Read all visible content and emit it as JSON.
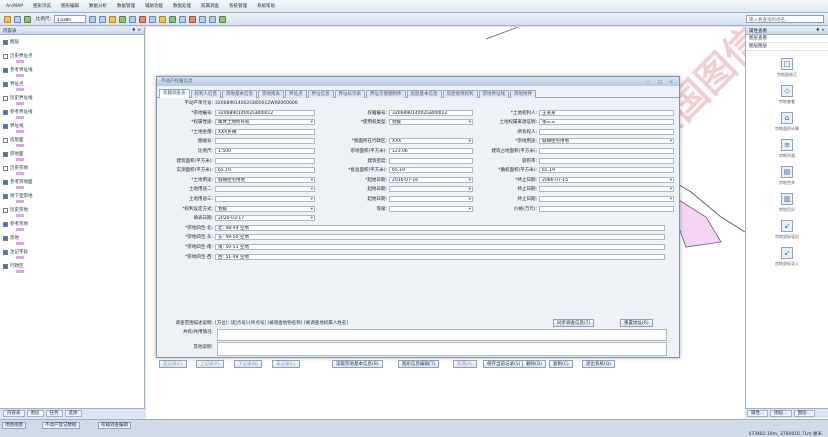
{
  "menubar": {
    "items": [
      "ArcMAP",
      "图形浏览",
      "图形编辑",
      "数据分析",
      "数据管理",
      "辅助功能",
      "数据处理",
      "权属调查",
      "系统管理",
      "系统帮助"
    ]
  },
  "toolbar": {
    "scale_label": "比例尺:",
    "scale_value": "1:1250",
    "search_placeholder": "输入要查询的地名..."
  },
  "left_panel": {
    "title": "内容表",
    "pin": "♦ ×",
    "layers": [
      {
        "name": "图层",
        "checked": true
      },
      {
        "name": "历史界址点",
        "checked": false
      },
      {
        "name": "参考界址线",
        "checked": true
      },
      {
        "name": "界址点",
        "checked": true
      },
      {
        "name": "历史界址线",
        "checked": false
      },
      {
        "name": "参考界址线",
        "checked": true
      },
      {
        "name": "界址线",
        "checked": true
      },
      {
        "name": "房屋面",
        "checked": false
      },
      {
        "name": "宗地面",
        "checked": true
      },
      {
        "name": "历史宗地",
        "checked": false
      },
      {
        "name": "参考宗地面",
        "checked": true
      },
      {
        "name": "地下室宗地",
        "checked": true
      },
      {
        "name": "历史宗地",
        "checked": false
      },
      {
        "name": "参考宗地",
        "checked": true
      },
      {
        "name": "宗地",
        "checked": true
      },
      {
        "name": "注记字段",
        "checked": true
      },
      {
        "name": "行政区",
        "checked": true
      }
    ],
    "tabs": [
      "内容表",
      "图层",
      "任务",
      "选择"
    ]
  },
  "statusbar": {
    "tabs": [
      "地图视图",
      "不动产登记数据",
      "权籍调查编辑"
    ],
    "coords": "473482.18m, 3780016.71m  厘米"
  },
  "right_panel": {
    "title": "属性查看",
    "pin": "♦ ×",
    "rows": [
      "图层查看",
      "图层图层"
    ],
    "tools": [
      {
        "glyph": "□",
        "label": "宗地面修正"
      },
      {
        "glyph": "◇",
        "label": "宗地查看"
      },
      {
        "glyph": "⌂",
        "label": "宗地面积计算"
      },
      {
        "glyph": "≡",
        "label": "宗地列表"
      },
      {
        "glyph": "▤",
        "label": "宗地合并"
      },
      {
        "glyph": "▥",
        "label": "宗地切分"
      },
      {
        "glyph": "↙",
        "label": "宗地坐标导出"
      },
      {
        "glyph": "↙",
        "label": "宗地坐标导入"
      }
    ],
    "bottom_tabs": [
      "属性...",
      "图层...",
      "图层..."
    ]
  },
  "watermark": "南京国图信息",
  "dialog": {
    "title": "不动产权籍信息",
    "tabs": [
      "权籍调查表",
      "权利人信息",
      "宗地基本信息",
      "宗地附表",
      "界址点",
      "界址信息",
      "界址标示表",
      "界址示意图附件",
      "房屋基本信息",
      "房屋他项权利",
      "宗地界址线",
      "宗地附件"
    ],
    "fields": [
      {
        "label": "不动产单元号:",
        "value": "320689014002GB00012W00000000",
        "x": 0,
        "y": 0,
        "lw": 40,
        "vw": 0
      },
      {
        "label": "*宗地编号:",
        "value": "320689014002GB00012",
        "x": 0,
        "y": 1,
        "lw": 40,
        "vw": 130
      },
      {
        "label": "权籍编号:",
        "value": "320689014002GB00012",
        "x": 1,
        "y": 1,
        "lw": 50,
        "vw": 80
      },
      {
        "label": "*土地权利人:",
        "value": "王某某",
        "x": 2,
        "y": 1,
        "lw": 40,
        "vw": 80
      },
      {
        "label": "*权属性质:",
        "value": "集体土地所有权",
        "x": 0,
        "y": 2,
        "lw": 40,
        "vw": 130,
        "sel": true
      },
      {
        "label": "*使用权类型:",
        "value": "划拨",
        "x": 1,
        "y": 2,
        "lw": 50,
        "vw": 80,
        "sel": true
      },
      {
        "label": "土地权属来源证明:",
        "value": "张三三",
        "x": 2,
        "y": 2,
        "lw": 40,
        "vw": 80
      },
      {
        "label": "*土地坐落:",
        "value": "XXX乡镇",
        "x": 0,
        "y": 3,
        "lw": 40,
        "vw": 130
      },
      {
        "label": "所有权人:",
        "value": "",
        "x": 2,
        "y": 3,
        "lw": 40,
        "vw": 80
      },
      {
        "label": "图幅号:",
        "value": "",
        "x": 0,
        "y": 4,
        "lw": 40,
        "vw": 130
      },
      {
        "label": "*图面所在行政区:",
        "value": "XXX",
        "x": 1,
        "y": 4,
        "lw": 50,
        "vw": 80,
        "sel": true
      },
      {
        "label": "*宗地用途:",
        "value": "城镇住宅用地",
        "x": 2,
        "y": 4,
        "lw": 40,
        "vw": 80,
        "sel": true
      },
      {
        "label": "比例尺:",
        "value": "1:500",
        "x": 0,
        "y": 5,
        "lw": 40,
        "vw": 130
      },
      {
        "label": "宗地面积(平方米):",
        "value": "123.06",
        "x": 1,
        "y": 5,
        "lw": 50,
        "vw": 80
      },
      {
        "label": "建筑占地面积(平方米):",
        "value": "",
        "x": 2,
        "y": 5,
        "lw": 40,
        "vw": 80
      },
      {
        "label": "建筑面积(平方米):",
        "value": "",
        "x": 0,
        "y": 6,
        "lw": 40,
        "vw": 130
      },
      {
        "label": "建筑密度:",
        "value": "",
        "x": 1,
        "y": 6,
        "lw": 50,
        "vw": 80
      },
      {
        "label": "容积率:",
        "value": "",
        "x": 2,
        "y": 6,
        "lw": 40,
        "vw": 80
      },
      {
        "label": "实测面积(平方米):",
        "value": "65.19",
        "x": 0,
        "y": 7,
        "lw": 40,
        "vw": 130
      },
      {
        "label": "*批准面积(平方米):",
        "value": "65.19",
        "x": 1,
        "y": 7,
        "lw": 50,
        "vw": 80
      },
      {
        "label": "*确权面积(平方米):",
        "value": "65.19",
        "x": 2,
        "y": 7,
        "lw": 40,
        "vw": 80
      },
      {
        "label": "*土地用途:",
        "value": "城镇住宅用地",
        "x": 0,
        "y": 8,
        "lw": 40,
        "vw": 130,
        "sel": true
      },
      {
        "label": "*起始日期:",
        "value": "2016-07-16",
        "x": 1,
        "y": 8,
        "lw": 50,
        "vw": 80,
        "sel": true
      },
      {
        "label": "*终止日期:",
        "value": "2086-07-15",
        "x": 2,
        "y": 8,
        "lw": 40,
        "vw": 80,
        "sel": true
      },
      {
        "label": "土地用途二:",
        "value": "",
        "x": 0,
        "y": 9,
        "lw": 40,
        "vw": 130,
        "sel": true
      },
      {
        "label": "起始日期:",
        "value": "",
        "x": 1,
        "y": 9,
        "lw": 50,
        "vw": 80,
        "sel": true
      },
      {
        "label": "终止日期:",
        "value": "",
        "x": 2,
        "y": 9,
        "lw": 40,
        "vw": 80,
        "sel": true
      },
      {
        "label": "土地用途三:",
        "value": "",
        "x": 0,
        "y": 10,
        "lw": 40,
        "vw": 130,
        "sel": true
      },
      {
        "label": "起始日期:",
        "value": "",
        "x": 1,
        "y": 10,
        "lw": 50,
        "vw": 80,
        "sel": true
      },
      {
        "label": "终止日期:",
        "value": "",
        "x": 2,
        "y": 10,
        "lw": 40,
        "vw": 80,
        "sel": true
      },
      {
        "label": "*权利设定方式:",
        "value": "划拨",
        "x": 0,
        "y": 11,
        "lw": 40,
        "vw": 130,
        "sel": true
      },
      {
        "label": "等级:",
        "value": "",
        "x": 1,
        "y": 11,
        "lw": 50,
        "vw": 80,
        "sel": true
      },
      {
        "label": "价格(万元):",
        "value": "",
        "x": 2,
        "y": 11,
        "lw": 40,
        "vw": 80
      },
      {
        "label": "填表日期:",
        "value": "2020-03-17",
        "x": 0,
        "y": 12,
        "lw": 40,
        "vw": 130,
        "sel": true
      },
      {
        "label": "*宗地四至-北:",
        "value": "北: 48-49 空地",
        "x": 0,
        "y": 13,
        "lw": 40,
        "vw": 460
      },
      {
        "label": "*宗地四至-东:",
        "value": "东: 49-50 空地",
        "x": 0,
        "y": 14,
        "lw": 40,
        "vw": 460
      },
      {
        "label": "*宗地四至-南:",
        "value": "南: 50-51 空地",
        "x": 0,
        "y": 15,
        "lw": 40,
        "vw": 460
      },
      {
        "label": "*宗地四至-西:",
        "value": "西: 51-48 空地",
        "x": 0,
        "y": 16,
        "lw": 40,
        "vw": 460
      }
    ],
    "scope_label": "调查范围描述说明:",
    "scope_value": "[方位]: [起点号]-[终点号] [被调查地物名称] [被调查地权属人姓名]",
    "sync_button": "同步调查信息(T)",
    "reset_button": "重置地址(R)",
    "notes_label_1": "共有/共用情况:",
    "notes_label_2": "其他说明:",
    "buttons": [
      "首记录(F)",
      "上记录(P)",
      "下记录(N)",
      "末记录(L)",
      "读取宗地基本信息(B)",
      "图形信息编辑(T)",
      "新增(A)",
      "保存当前记录(S)",
      "删除(D)",
      "复制(C)",
      "退出系统(Q)"
    ]
  }
}
